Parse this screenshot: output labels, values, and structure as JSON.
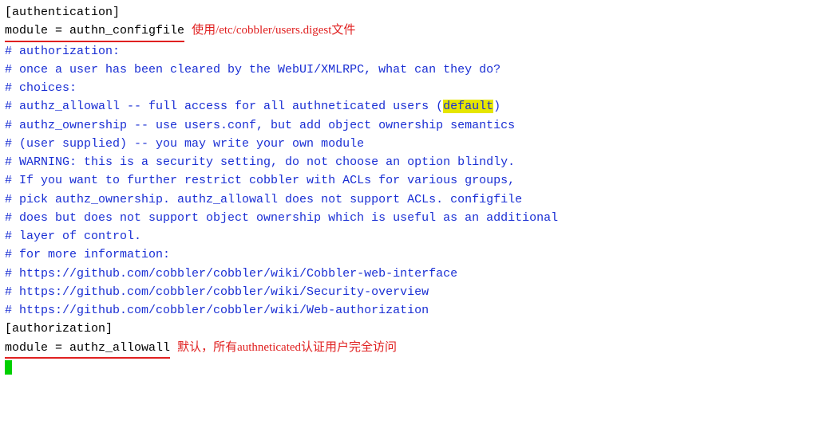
{
  "line1": "[authentication]",
  "line2_code": "module = authn_configfile ",
  "line2_anno": "使用/etc/cobbler/users.digest文件",
  "blank1": " ",
  "c1": "# authorization:",
  "c2": "# once a user has been cleared by the WebUI/XMLRPC, what can they do?",
  "c3": "# choices:",
  "c4a": "#    authz_allowall   -- full access for all authneticated users (",
  "c4_hl": "default",
  "c4b": ")",
  "c5": "#    authz_ownership  -- use users.conf, but add object ownership semantics",
  "c6": "#    (user supplied)  -- you may write your own module",
  "c7": "# WARNING: this is a security setting, do not choose an option blindly.",
  "c8": "# If you want to further restrict cobbler with ACLs for various groups,",
  "c9": "# pick authz_ownership.  authz_allowall does not support ACLs.  configfile",
  "c10": "# does but does not support object ownership which is useful as an additional",
  "c11": "# layer of control.",
  "blank2": " ",
  "c12": "# for more information:",
  "c13": "# https://github.com/cobbler/cobbler/wiki/Cobbler-web-interface",
  "c14": "# https://github.com/cobbler/cobbler/wiki/Security-overview",
  "c15": "# https://github.com/cobbler/cobbler/wiki/Web-authorization",
  "blank3": " ",
  "line_authz": "[authorization]",
  "line_mod2": "module = authz_allowall ",
  "line_mod2_anno": "默认，所有authneticated认证用户完全访问"
}
